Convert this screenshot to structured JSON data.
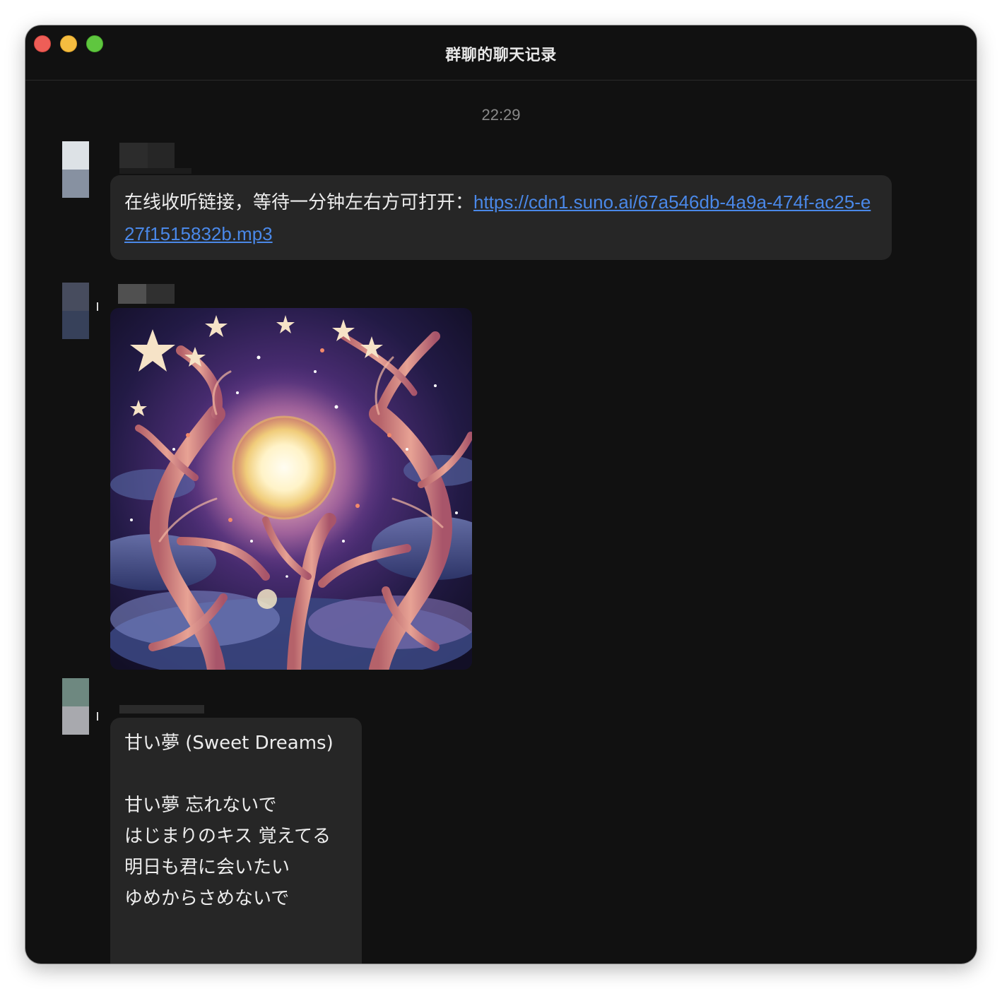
{
  "window": {
    "title": "群聊的聊天记录",
    "controls": {
      "close": "close-button",
      "minimize": "minimize-button",
      "zoom": "zoom-button"
    }
  },
  "colors": {
    "window_bg": "#111111",
    "bubble_bg": "#262626",
    "link": "#4a88e8",
    "timestamp": "#8a8a8a",
    "text": "#ededed"
  },
  "chat": {
    "timestamp": "22:29",
    "messages": [
      {
        "type": "text-with-link",
        "text": "在线收听链接，等待一分钟左右方可打开：",
        "link": "https://cdn1.suno.ai/67a546db-4a9a-474f-ac25-e27f1515832b.mp3"
      },
      {
        "type": "image",
        "image": "cosmic-trees-artwork"
      },
      {
        "type": "lyrics",
        "title": "甘い夢 (Sweet Dreams)",
        "lines": [
          "甘い夢 忘れないで",
          "はじまりのキス 覚えてる",
          "明日も君に会いたい",
          "ゆめからさめないで"
        ]
      }
    ]
  }
}
